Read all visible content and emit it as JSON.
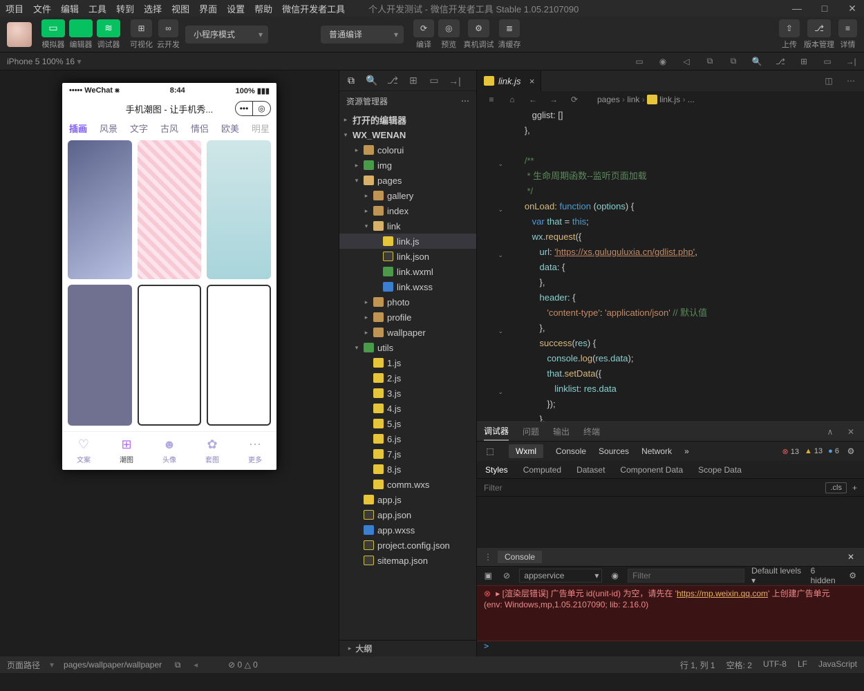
{
  "menubar": {
    "items": [
      "项目",
      "文件",
      "编辑",
      "工具",
      "转到",
      "选择",
      "视图",
      "界面",
      "设置",
      "帮助",
      "微信开发者工具"
    ],
    "title": "个人开发测试 - 微信开发者工具 Stable 1.05.2107090"
  },
  "window": {
    "min": "—",
    "max": "□",
    "close": "✕"
  },
  "toolbar": {
    "groups": [
      {
        "label": "模拟器",
        "icon": "▭"
      },
      {
        "label": "编辑器",
        "icon": "</>"
      },
      {
        "label": "调试器",
        "icon": "≋"
      }
    ],
    "gray": [
      {
        "label": "可视化",
        "icon": "⊞"
      },
      {
        "label": "云开发",
        "icon": "∞"
      }
    ],
    "mode_select": "小程序模式",
    "compile_select": "普通编译",
    "mid": [
      {
        "label": "编译",
        "icon": "⟳"
      },
      {
        "label": "预览",
        "icon": "◎"
      },
      {
        "label": "真机调试",
        "icon": "⚙"
      },
      {
        "label": "清缓存",
        "icon": "≣"
      }
    ],
    "right": [
      {
        "label": "上传",
        "icon": "⇧"
      },
      {
        "label": "版本管理",
        "icon": "⎇"
      },
      {
        "label": "详情",
        "icon": "≡"
      }
    ]
  },
  "devbar": {
    "device": "iPhone 5 100% 16",
    "caret": "▾",
    "icons": [
      "▭",
      "◉",
      "◁",
      "⧉",
      "⧉",
      "🔍",
      "⎇",
      "⊞",
      "▭",
      "→|"
    ]
  },
  "simulator": {
    "status": {
      "left": "••••• WeChat ⨳",
      "time": "8:44",
      "right": "100%  ▮▮▮"
    },
    "title": "手机潮图 - 让手机秀...",
    "caps": [
      "•••",
      "◎"
    ],
    "tabs": [
      "插画",
      "风景",
      "文字",
      "古风",
      "情侣",
      "欧美",
      "明星"
    ],
    "tabbar": [
      {
        "icon": "♡",
        "label": "文案"
      },
      {
        "icon": "⊞",
        "label": "潮图"
      },
      {
        "icon": "☻",
        "label": "头像"
      },
      {
        "icon": "✿",
        "label": "套图"
      },
      {
        "icon": "⋯",
        "label": "更多"
      }
    ]
  },
  "explorer": {
    "header": "资源管理器",
    "sections": {
      "opened": "打开的编辑器",
      "project": "WX_WENAN",
      "outline": "大纲"
    },
    "tree": [
      {
        "d": 1,
        "t": "folder",
        "n": "colorui"
      },
      {
        "d": 1,
        "t": "folder-g",
        "n": "img"
      },
      {
        "d": 1,
        "t": "folder-o",
        "n": "pages",
        "open": true
      },
      {
        "d": 2,
        "t": "folder",
        "n": "gallery"
      },
      {
        "d": 2,
        "t": "folder",
        "n": "index"
      },
      {
        "d": 2,
        "t": "folder-o",
        "n": "link",
        "open": true
      },
      {
        "d": 3,
        "t": "js",
        "n": "link.js",
        "sel": true
      },
      {
        "d": 3,
        "t": "json",
        "n": "link.json"
      },
      {
        "d": 3,
        "t": "wxml",
        "n": "link.wxml"
      },
      {
        "d": 3,
        "t": "wxss",
        "n": "link.wxss"
      },
      {
        "d": 2,
        "t": "folder",
        "n": "photo"
      },
      {
        "d": 2,
        "t": "folder",
        "n": "profile"
      },
      {
        "d": 2,
        "t": "folder",
        "n": "wallpaper"
      },
      {
        "d": 1,
        "t": "folder-g",
        "n": "utils",
        "open": true
      },
      {
        "d": 2,
        "t": "js",
        "n": "1.js"
      },
      {
        "d": 2,
        "t": "js",
        "n": "2.js"
      },
      {
        "d": 2,
        "t": "js",
        "n": "3.js"
      },
      {
        "d": 2,
        "t": "js",
        "n": "4.js"
      },
      {
        "d": 2,
        "t": "js",
        "n": "5.js"
      },
      {
        "d": 2,
        "t": "js",
        "n": "6.js"
      },
      {
        "d": 2,
        "t": "js",
        "n": "7.js"
      },
      {
        "d": 2,
        "t": "js",
        "n": "8.js"
      },
      {
        "d": 2,
        "t": "wxs",
        "n": "comm.wxs"
      },
      {
        "d": 1,
        "t": "js",
        "n": "app.js"
      },
      {
        "d": 1,
        "t": "json",
        "n": "app.json"
      },
      {
        "d": 1,
        "t": "wxss",
        "n": "app.wxss"
      },
      {
        "d": 1,
        "t": "json",
        "n": "project.config.json"
      },
      {
        "d": 1,
        "t": "json",
        "n": "sitemap.json"
      }
    ]
  },
  "editor": {
    "tab": "link.js",
    "breadcrumb": [
      "pages",
      "link",
      "link.js",
      "..."
    ],
    "icons": [
      "≡",
      "⌂",
      "←",
      "→",
      "⟳"
    ],
    "lines": [
      {
        "n": "",
        "h": "      gglist: []"
      },
      {
        "n": "",
        "h": "   },"
      },
      {
        "n": "",
        "h": ""
      },
      {
        "n": "",
        "h": "   <span class='cm'>/**</span>"
      },
      {
        "n": "",
        "h": "   <span class='cm'> * 生命周期函数--监听页面加载</span>"
      },
      {
        "n": "",
        "h": "   <span class='cm'> */</span>"
      },
      {
        "n": "",
        "h": "   <span class='fn'>onLoad</span>: <span class='kw'>function</span> (<span class='pr'>options</span>) {"
      },
      {
        "n": "",
        "h": "      <span class='kw'>var</span> <span class='pr'>that</span> = <span class='this'>this</span>;"
      },
      {
        "n": "",
        "h": "      <span class='pr'>wx</span>.<span class='fn'>request</span>({"
      },
      {
        "n": "",
        "h": "         <span class='pr'>url</span>: <span class='url'>'https://xs.guluguluxia.cn/gdlist.php'</span>,"
      },
      {
        "n": "",
        "h": "         <span class='pr'>data</span>: {"
      },
      {
        "n": "",
        "h": "         },"
      },
      {
        "n": "",
        "h": "         <span class='pr'>header</span>: {"
      },
      {
        "n": "",
        "h": "            <span class='str'>'content-type'</span>: <span class='str'>'application/json'</span> <span class='cm'>// 默认值</span>"
      },
      {
        "n": "",
        "h": "         },"
      },
      {
        "n": "",
        "h": "         <span class='fn'>success</span>(<span class='pr'>res</span>) {"
      },
      {
        "n": "",
        "h": "            <span class='pr'>console</span>.<span class='fn'>log</span>(<span class='pr'>res</span>.<span class='pr'>data</span>);"
      },
      {
        "n": "",
        "h": "            <span class='pr'>that</span>.<span class='fn'>setData</span>({"
      },
      {
        "n": "",
        "h": "               <span class='pr'>linklist</span>: <span class='pr'>res</span>.<span class='pr'>data</span>"
      },
      {
        "n": "",
        "h": "            });"
      },
      {
        "n": "",
        "h": "         },"
      },
      {
        "n": "",
        "h": "      })"
      }
    ],
    "folds": [
      3,
      6,
      9,
      14,
      18
    ]
  },
  "debugger": {
    "tabs": [
      "调试器",
      "问题",
      "输出",
      "终端"
    ],
    "devtools": [
      "Wxml",
      "Console",
      "Sources",
      "Network"
    ],
    "devmore": "»",
    "badges": {
      "err": "13",
      "wrn": "13",
      "inf": "6"
    },
    "style_tabs": [
      "Styles",
      "Computed",
      "Dataset",
      "Component Data",
      "Scope Data"
    ],
    "filter_ph": "Filter",
    "cls": ".cls",
    "plus": "+",
    "console_hdr": "Console",
    "ctx": "appservice",
    "filter2_ph": "Filter",
    "levels": "Default levels",
    "hidden": "6 hidden",
    "err_line1": "▸ [渲染层错误] 广告单元 id(unit-id) 为空，请先在 '",
    "err_link": "https://mp.weixin.qq.com",
    "err_line1b": "' 上创建广告单元",
    "err_line2": "(env: Windows,mp,1.05.2107090; lib: 2.16.0)",
    "prompt": ">"
  },
  "status": {
    "path_label": "页面路径",
    "path": "pages/wallpaper/wallpaper",
    "warn": "⊘ 0 △ 0",
    "right": [
      "行 1, 列 1",
      "空格: 2",
      "UTF-8",
      "LF",
      "JavaScript"
    ]
  }
}
